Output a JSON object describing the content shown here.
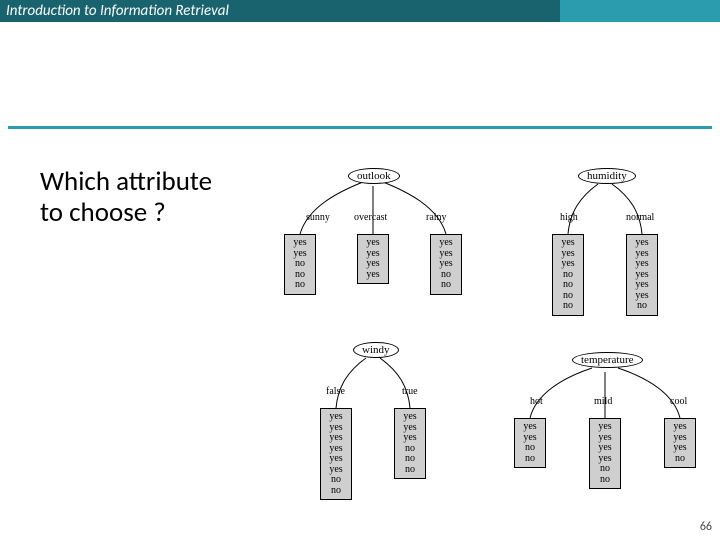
{
  "header": {
    "title": "Introduction to Information Retrieval"
  },
  "body": {
    "title_line1": "Which attribute",
    "title_line2": "to choose ?"
  },
  "page_number": "66",
  "trees": {
    "outlook": {
      "root": "outlook",
      "branches": [
        {
          "label": "sunny",
          "leaf": "yes\nyes\nno\nno\nno"
        },
        {
          "label": "overcast",
          "leaf": "yes\nyes\nyes\nyes"
        },
        {
          "label": "rainy",
          "leaf": "yes\nyes\nyes\nno\nno"
        }
      ]
    },
    "humidity": {
      "root": "humidity",
      "branches": [
        {
          "label": "high",
          "leaf": "yes\nyes\nyes\nno\nno\nno\nno"
        },
        {
          "label": "normal",
          "leaf": "yes\nyes\nyes\nyes\nyes\nyes\nno"
        }
      ]
    },
    "windy": {
      "root": "windy",
      "branches": [
        {
          "label": "false",
          "leaf": "yes\nyes\nyes\nyes\nyes\nyes\nno\nno"
        },
        {
          "label": "true",
          "leaf": "yes\nyes\nyes\nno\nno\nno"
        }
      ]
    },
    "temperature": {
      "root": "temperature",
      "branches": [
        {
          "label": "hot",
          "leaf": "yes\nyes\nno\nno"
        },
        {
          "label": "mild",
          "leaf": "yes\nyes\nyes\nyes\nno\nno"
        },
        {
          "label": "cool",
          "leaf": "yes\nyes\nyes\nno"
        }
      ]
    }
  }
}
